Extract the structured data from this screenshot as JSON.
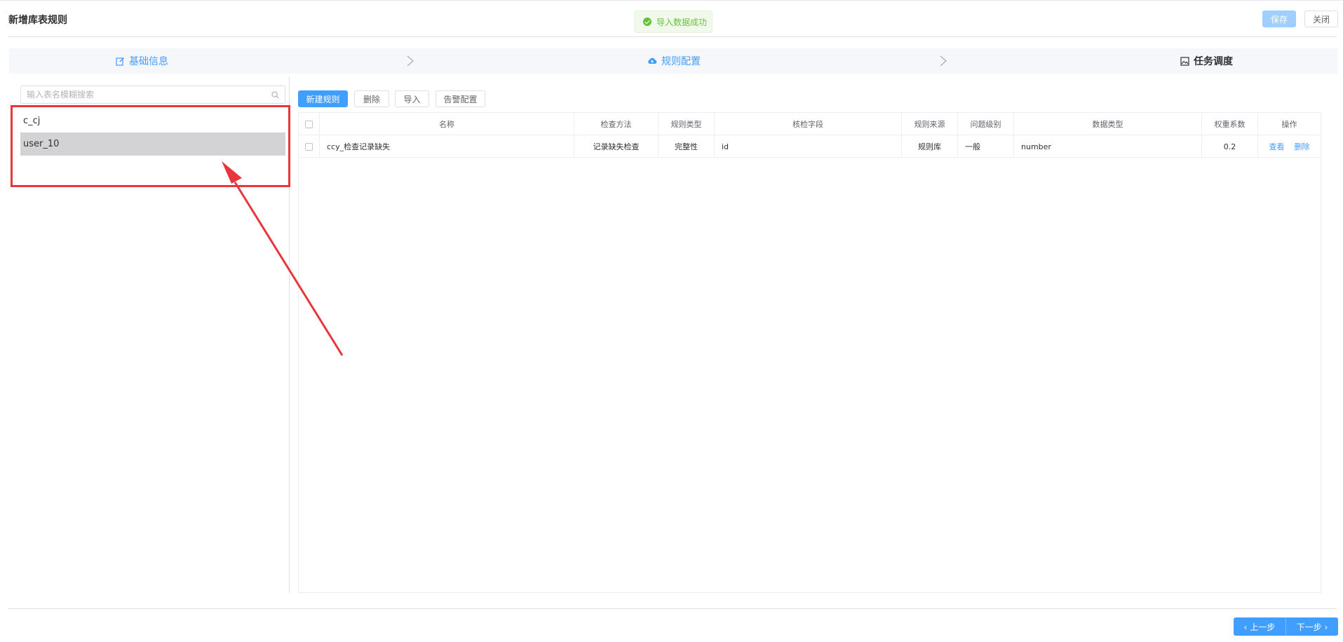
{
  "header": {
    "title": "新增库表规则",
    "toast": "导入数据成功",
    "save_label": "保存",
    "close_label": "关闭"
  },
  "steps": [
    {
      "label": "基础信息",
      "icon": "edit-icon"
    },
    {
      "label": "规则配置",
      "icon": "cloud-upload-icon"
    },
    {
      "label": "任务调度",
      "icon": "image-icon"
    }
  ],
  "sidebar": {
    "search_placeholder": "输入表名模糊搜索",
    "items": [
      {
        "label": "c_cj",
        "selected": false
      },
      {
        "label": "user_10",
        "selected": true
      }
    ]
  },
  "toolbar": {
    "new_rule": "新建规则",
    "delete": "删除",
    "import": "导入",
    "alert_config": "告警配置"
  },
  "table": {
    "columns": [
      "名称",
      "检查方法",
      "规则类型",
      "核检字段",
      "规则来源",
      "问题级别",
      "数据类型",
      "权重系数",
      "操作"
    ],
    "rows": [
      {
        "name": "ccy_检查记录缺失",
        "method": "记录缺失检查",
        "rule_type": "完整性",
        "field": "id",
        "source": "规则库",
        "level": "一般",
        "data_type": "number",
        "weight": "0.2",
        "view": "查看",
        "delete": "删除"
      }
    ]
  },
  "footer": {
    "prev": "上一步",
    "next": "下一步"
  },
  "colors": {
    "primary": "#409eff",
    "success": "#67c23a",
    "annotation": "#e8373c"
  }
}
